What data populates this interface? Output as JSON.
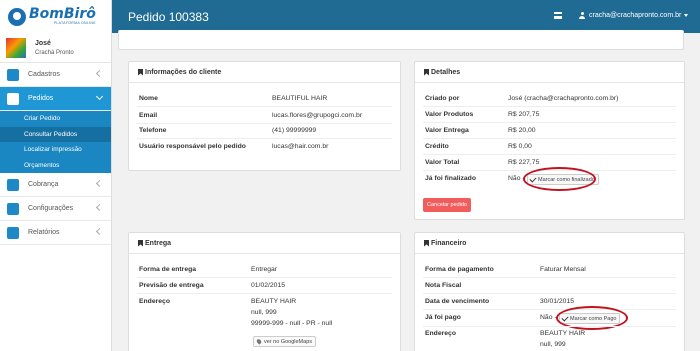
{
  "brand": {
    "name": "BomBirô",
    "tagline": "PLATAFORMA ONLINE"
  },
  "user": {
    "name": "José",
    "role": "Crachá Pronto"
  },
  "header": {
    "title": "Pedido 100383",
    "account": "cracha@crachapronto.com.br"
  },
  "sidebar": {
    "items": [
      {
        "label": "Cadastros"
      },
      {
        "label": "Pedidos"
      },
      {
        "label": "Cobrança"
      },
      {
        "label": "Configurações"
      },
      {
        "label": "Relatórios"
      }
    ],
    "pedidos_sub": [
      {
        "label": "Criar Pedido"
      },
      {
        "label": "Consultar Pedidos"
      },
      {
        "label": "Localizar impressão"
      },
      {
        "label": "Orçamentos"
      }
    ]
  },
  "cliente": {
    "title": "Informações do cliente",
    "rows": [
      {
        "label": "Nome",
        "value": "BEAUTIFUL HAIR"
      },
      {
        "label": "Email",
        "value": "lucas.flores@grupogci.com.br"
      },
      {
        "label": "Telefone",
        "value": "(41) 99999999"
      },
      {
        "label": "Usuário responsável pelo pedido",
        "value": "lucas@hair.com.br"
      }
    ]
  },
  "detalhes": {
    "title": "Detalhes",
    "rows": [
      {
        "label": "Criado por",
        "value": "José (cracha@crachapronto.com.br)"
      },
      {
        "label": "Valor Produtos",
        "value": "R$ 207,75"
      },
      {
        "label": "Valor Entrega",
        "value": "R$ 20,00"
      },
      {
        "label": "Crédito",
        "value": "R$ 0,00"
      },
      {
        "label": "Valor Total",
        "value": "R$ 227,75"
      },
      {
        "label": "Já foi finalizado",
        "value": "Não -"
      }
    ],
    "mark_finished": "Marcar como finalizado",
    "cancel": "Cancelar pedido"
  },
  "entrega": {
    "title": "Entrega",
    "rows": [
      {
        "label": "Forma de entrega",
        "value": "Entregar"
      },
      {
        "label": "Previsão de entrega",
        "value": "01/02/2015"
      },
      {
        "label": "Endereço",
        "value": "BEAUTY HAIR"
      }
    ],
    "address_lines": [
      "null, 999",
      "99999-999 - null - PR - null"
    ],
    "maps": "ver no GoogleMaps"
  },
  "financeiro": {
    "title": "Financeiro",
    "rows": [
      {
        "label": "Forma de pagamento",
        "value": "Faturar Mensal"
      },
      {
        "label": "Nota Fiscal",
        "value": ""
      },
      {
        "label": "Data de vencimento",
        "value": "30/01/2015"
      },
      {
        "label": "Já foi pago",
        "value": "Não -"
      },
      {
        "label": "Endereço",
        "value": "BEAUTY HAIR"
      }
    ],
    "address_lines": [
      "null, 999"
    ],
    "mark_paid": "Marcar como Pago"
  },
  "colors": {
    "topbar": "#1f6b93",
    "accent": "#1f97d4",
    "danger": "#f15d5d",
    "annotation": "#c0121f"
  }
}
